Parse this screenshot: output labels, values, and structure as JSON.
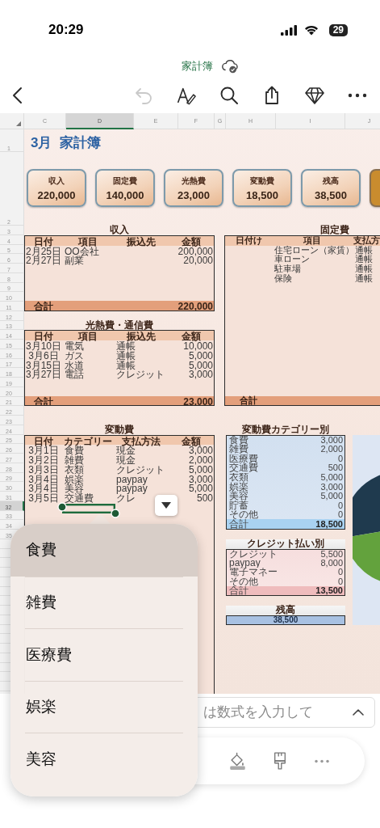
{
  "status_bar": {
    "time": "20:29",
    "battery": "29"
  },
  "document": {
    "title": "家計簿"
  },
  "toolbar": {
    "buttons": [
      {
        "kind": "back",
        "disabled": false
      },
      {
        "kind": "undo",
        "disabled": true
      },
      {
        "kind": "draw",
        "disabled": false
      },
      {
        "kind": "search",
        "disabled": false
      },
      {
        "kind": "share",
        "disabled": false
      },
      {
        "kind": "premium",
        "disabled": false
      },
      {
        "kind": "more",
        "disabled": false
      }
    ]
  },
  "sheet": {
    "columns": [
      {
        "label": "C",
        "selected": false
      },
      {
        "label": "D",
        "selected": true
      },
      {
        "label": "E",
        "selected": false
      },
      {
        "label": "F",
        "selected": false
      },
      {
        "label": "G",
        "selected": false
      },
      {
        "label": "H",
        "selected": false
      },
      {
        "label": "I",
        "selected": false
      },
      {
        "label": "J",
        "selected": false
      }
    ],
    "rows": [
      {
        "label": "1",
        "selected": false
      },
      {
        "label": "2",
        "selected": false
      },
      {
        "label": "3",
        "selected": false
      },
      {
        "label": "4",
        "selected": false
      },
      {
        "label": "5",
        "selected": false
      },
      {
        "label": "6",
        "selected": false
      },
      {
        "label": "7",
        "selected": false
      },
      {
        "label": "8",
        "selected": false
      },
      {
        "label": "9",
        "selected": false
      },
      {
        "label": "10",
        "selected": false
      },
      {
        "label": "11",
        "selected": false
      },
      {
        "label": "12",
        "selected": false
      },
      {
        "label": "13",
        "selected": false
      },
      {
        "label": "14",
        "selected": false
      },
      {
        "label": "15",
        "selected": false
      },
      {
        "label": "16",
        "selected": false
      },
      {
        "label": "17",
        "selected": false
      },
      {
        "label": "18",
        "selected": false
      },
      {
        "label": "19",
        "selected": false
      },
      {
        "label": "20",
        "selected": false
      },
      {
        "label": "21",
        "selected": false
      },
      {
        "label": "22",
        "selected": false
      },
      {
        "label": "23",
        "selected": false
      },
      {
        "label": "24",
        "selected": false
      },
      {
        "label": "25",
        "selected": false
      },
      {
        "label": "26",
        "selected": false
      },
      {
        "label": "27",
        "selected": false
      },
      {
        "label": "28",
        "selected": false
      },
      {
        "label": "29",
        "selected": false
      },
      {
        "label": "30",
        "selected": false
      },
      {
        "label": "31",
        "selected": false
      },
      {
        "label": "32",
        "selected": true
      },
      {
        "label": "33",
        "selected": false
      },
      {
        "label": "34",
        "selected": false
      },
      {
        "label": "35",
        "selected": false
      }
    ],
    "title": "3月  家計簿",
    "cards": [
      {
        "kind": "summary",
        "label": "収入",
        "value": "220,000"
      },
      {
        "kind": "summary",
        "label": "固定費",
        "value": "140,000"
      },
      {
        "kind": "summary",
        "label": "光熱費",
        "value": "23,000"
      },
      {
        "kind": "summary",
        "label": "変動費",
        "value": "18,500"
      },
      {
        "kind": "summary",
        "label": "残高",
        "value": "38,500"
      },
      {
        "kind": "cut"
      }
    ],
    "left_column": {
      "tables": [
        {
          "kind": "ledger",
          "title": "収入",
          "columns": [
            "日付",
            "項目",
            "振込先",
            "金額"
          ],
          "rows": [
            {
              "date": "2月25日",
              "item": "OO会社",
              "amount": "200,000"
            },
            {
              "date": "2月27日",
              "item": "副業",
              "amount": "20,000"
            }
          ],
          "total": {
            "label": "合計",
            "amount": "220,000"
          }
        },
        {
          "kind": "ledger",
          "title": "光熱費・通信費",
          "columns": [
            "日付",
            "項目",
            "振込先",
            "金額"
          ],
          "rows": [
            {
              "date": "3月10日",
              "item": "電気",
              "account": "通帳",
              "amount": "10,000"
            },
            {
              "date": "3月6日",
              "item": "ガス",
              "account": "通帳",
              "amount": "5,000"
            },
            {
              "date": "3月15日",
              "item": "水道",
              "account": "通帳",
              "amount": "5,000"
            },
            {
              "date": "3月27日",
              "item": "電話",
              "account": "クレジット",
              "amount": "3,000"
            }
          ],
          "total": {
            "label": "合計",
            "amount": "23,000"
          }
        },
        {
          "kind": "ledger",
          "title": "変動費",
          "columns": [
            "日付",
            "カテゴリー",
            "支払方法",
            "金額"
          ],
          "rows": [
            {
              "date": "3月1日",
              "item": "食費",
              "account": "現金",
              "amount": "3,000"
            },
            {
              "date": "3月2日",
              "item": "雑費",
              "account": "現金",
              "amount": "2,000"
            },
            {
              "date": "3月3日",
              "item": "衣類",
              "account": "クレジット",
              "amount": "5,000"
            },
            {
              "date": "3月4日",
              "item": "娯楽",
              "account": "paypay",
              "amount": "3,000"
            },
            {
              "date": "3月4日",
              "item": "美容",
              "account": "paypay",
              "amount": "5,000"
            },
            {
              "date": "3月5日",
              "item": "交通費",
              "account": "クレ",
              "amount": "500"
            }
          ]
        }
      ]
    },
    "right_column": {
      "tables": [
        {
          "kind": "fixed",
          "title": "固定費",
          "columns": [
            "日付け",
            "項目",
            "支払方"
          ],
          "rows": [
            {
              "item": "住宅ローン（家賃）",
              "method": "通帳"
            },
            {
              "item": "車ローン",
              "method": "通帳"
            },
            {
              "item": "駐車場",
              "method": "通帳"
            },
            {
              "item": "保険",
              "method": "通帳"
            }
          ],
          "total": {
            "label": "合計"
          }
        },
        {
          "kind": "category_summary",
          "title": "変動費カテゴリー別",
          "rows": [
            {
              "label": "食費",
              "amount": "3,000"
            },
            {
              "label": "雑費",
              "amount": "2,000"
            },
            {
              "label": "医療費",
              "amount": "0"
            },
            {
              "label": "交通費",
              "amount": "500"
            },
            {
              "label": "衣類",
              "amount": "5,000"
            },
            {
              "label": "娯楽",
              "amount": "3,000"
            },
            {
              "label": "美容",
              "amount": "5,000"
            },
            {
              "label": "貯蓄",
              "amount": "0"
            },
            {
              "label": "その他",
              "amount": "0"
            }
          ],
          "total": {
            "label": "合計",
            "amount": "18,500"
          }
        },
        {
          "kind": "credit_summary",
          "title": "クレジット払い別",
          "rows": [
            {
              "label": "クレジット",
              "amount": "5,500"
            },
            {
              "label": "paypay",
              "amount": "8,000"
            },
            {
              "label": "電子マネー",
              "amount": "0"
            },
            {
              "label": "その他",
              "amount": "0"
            }
          ],
          "total": {
            "label": "合計",
            "amount": "13,500"
          }
        },
        {
          "kind": "balance",
          "title": "残高",
          "value": "38,500"
        }
      ]
    },
    "chart": {
      "kind": "pie"
    },
    "cell_dropdown": {
      "expanded": true
    }
  },
  "dropdown_menu": {
    "items": [
      {
        "label": "食費",
        "selected": true
      },
      {
        "label": "雑費",
        "selected": false
      },
      {
        "label": "医療費",
        "selected": false
      },
      {
        "label": "娯楽",
        "selected": false
      },
      {
        "label": "美容",
        "selected": false
      }
    ]
  },
  "formula_bar": {
    "placeholder": "は数式を入力して"
  },
  "bottom_toolbar": {
    "tools": [
      {
        "kind": "fill"
      },
      {
        "kind": "brush"
      },
      {
        "kind": "more"
      }
    ]
  }
}
